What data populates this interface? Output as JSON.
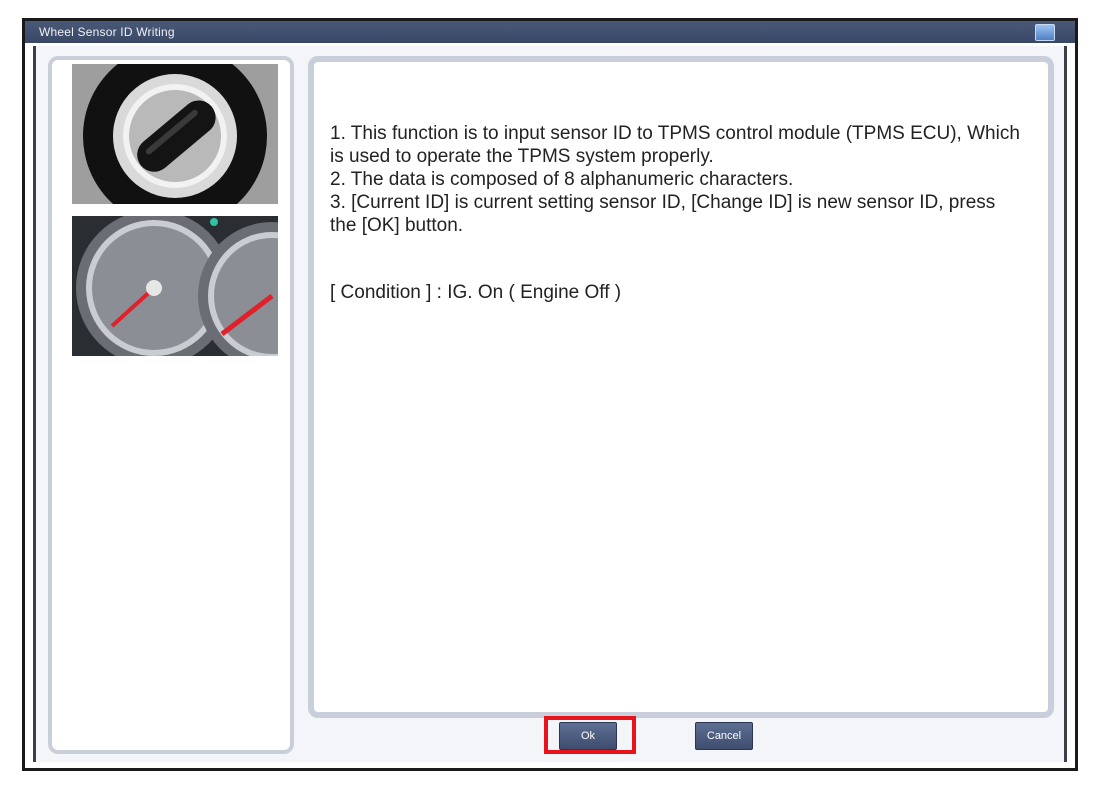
{
  "window": {
    "title": "Wheel Sensor ID Writing"
  },
  "instructions": {
    "line1": "1. This function is to input sensor ID to TPMS control module (TPMS ECU), Which is used to operate the TPMS system properly.",
    "line2": "2. The data is composed of 8 alphanumeric characters.",
    "line3": "3. [Current ID] is current setting sensor ID, [Change ID] is new sensor ID, press the [OK] button.",
    "condition": "[ Condition ] : IG. On ( Engine Off )"
  },
  "buttons": {
    "ok_label": "Ok",
    "cancel_label": "Cancel"
  },
  "colors": {
    "titlebar": "#3a4866",
    "panel_border": "#c8cfdb",
    "button": "#4a5a7d",
    "highlight": "#e8141c"
  },
  "icons": {
    "help": "help-icon"
  }
}
